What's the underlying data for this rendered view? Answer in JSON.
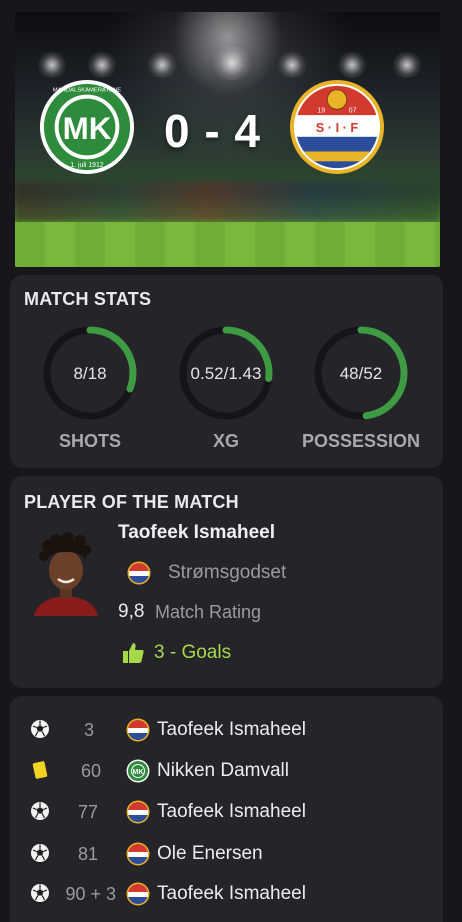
{
  "match": {
    "home_team": "FK Mandalskameratene",
    "home_crest_text": "1. juli 1912",
    "away_team": "Strømsgodset",
    "score": "0 - 4",
    "colors": {
      "home": "#2e8b3c",
      "away_red": "#d23a2f",
      "away_yellow": "#e9b428",
      "away_blue": "#2b4d9a"
    }
  },
  "stats": {
    "title": "MATCH STATS",
    "items": [
      {
        "label": "SHOTS",
        "value": "8/18",
        "home_share": 0.31
      },
      {
        "label": "XG",
        "value": "0.52/1.43",
        "home_share": 0.27
      },
      {
        "label": "POSSESSION",
        "value": "48/52",
        "home_share": 0.48
      }
    ],
    "ring_color": "#3f9a44",
    "track_color": "#151519"
  },
  "potm": {
    "title": "PLAYER OF THE MATCH",
    "name": "Taofeek Ismaheel",
    "team": "Strømsgodset",
    "rating": "9,8",
    "rating_label": "Match Rating",
    "goals": "3 - Goals",
    "goals_icon": "thumbs-up-icon"
  },
  "events": [
    {
      "type": "goal",
      "icon": "soccer-ball-icon",
      "minute": "3",
      "team": "away",
      "player": "Taofeek Ismaheel"
    },
    {
      "type": "yellow-card",
      "icon": "yellow-card-icon",
      "minute": "60",
      "team": "home",
      "player": "Nikken Damvall"
    },
    {
      "type": "goal",
      "icon": "soccer-ball-icon",
      "minute": "77",
      "team": "away",
      "player": "Taofeek Ismaheel"
    },
    {
      "type": "goal",
      "icon": "soccer-ball-icon",
      "minute": "81",
      "team": "away",
      "player": "Ole Enersen"
    },
    {
      "type": "goal",
      "icon": "soccer-ball-icon",
      "minute": "90 + 3",
      "team": "away",
      "player": "Taofeek Ismaheel"
    }
  ]
}
